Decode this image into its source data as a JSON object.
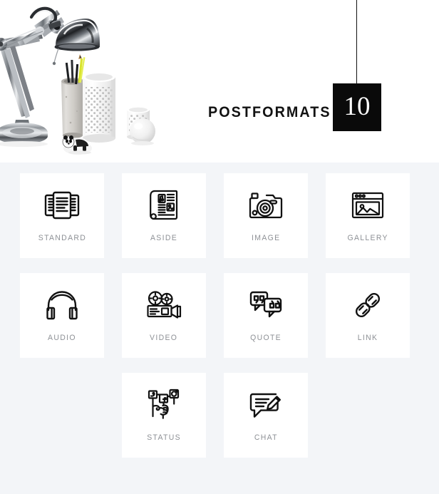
{
  "header": {
    "title": "POSTFORMATS",
    "badge_number": "10",
    "photo_alt": "desk-lamp-stationery-photo"
  },
  "colors": {
    "page_background": "#f3f5f8",
    "card_background": "#ffffff",
    "label_text": "#8d9095",
    "title_text": "#121212",
    "badge_background": "#0a0a0a",
    "badge_text": "#ffffff",
    "icon_stroke": "#111111"
  },
  "grid": {
    "rows": [
      {
        "align": "left",
        "cards": [
          {
            "label": "STANDARD",
            "icon": "standard-pages-icon"
          },
          {
            "label": "ASIDE",
            "icon": "newspaper-icon"
          },
          {
            "label": "IMAGE",
            "icon": "camera-icon"
          },
          {
            "label": "GALLERY",
            "icon": "browser-gallery-icon"
          }
        ]
      },
      {
        "align": "left",
        "cards": [
          {
            "label": "AUDIO",
            "icon": "headphones-icon"
          },
          {
            "label": "VIDEO",
            "icon": "movie-camera-icon"
          },
          {
            "label": "QUOTE",
            "icon": "quote-bubbles-icon"
          },
          {
            "label": "LINK",
            "icon": "chain-link-icon"
          }
        ]
      },
      {
        "align": "center",
        "cards": [
          {
            "label": "STATUS",
            "icon": "social-status-hand-icon"
          },
          {
            "label": "CHAT",
            "icon": "chat-pencil-icon"
          }
        ]
      }
    ]
  }
}
